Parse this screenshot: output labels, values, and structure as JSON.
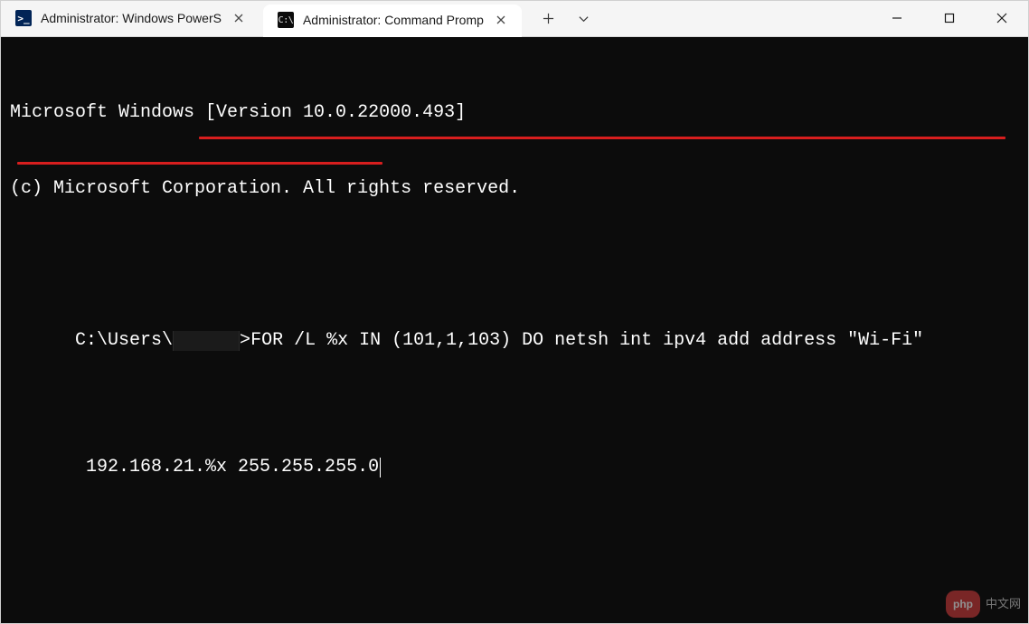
{
  "tabs": [
    {
      "label": "Administrator: Windows PowerS",
      "icon_glyph": ">_",
      "active": false
    },
    {
      "label": "Administrator: Command Promp",
      "icon_glyph": "C:\\",
      "active": true
    }
  ],
  "newtab_glyph": "+",
  "terminal": {
    "line1": "Microsoft Windows [Version 10.0.22000.493]",
    "line2": "(c) Microsoft Corporation. All rights reserved.",
    "prompt_prefix": "C:\\Users\\",
    "prompt_suffix": ">",
    "command_line1": "FOR /L %x IN (101,1,103) DO netsh int ipv4 add address \"Wi-Fi\"",
    "command_line2": " 192.168.21.%x 255.255.255.0"
  },
  "watermark": {
    "pill": "php",
    "text": "中文网"
  }
}
